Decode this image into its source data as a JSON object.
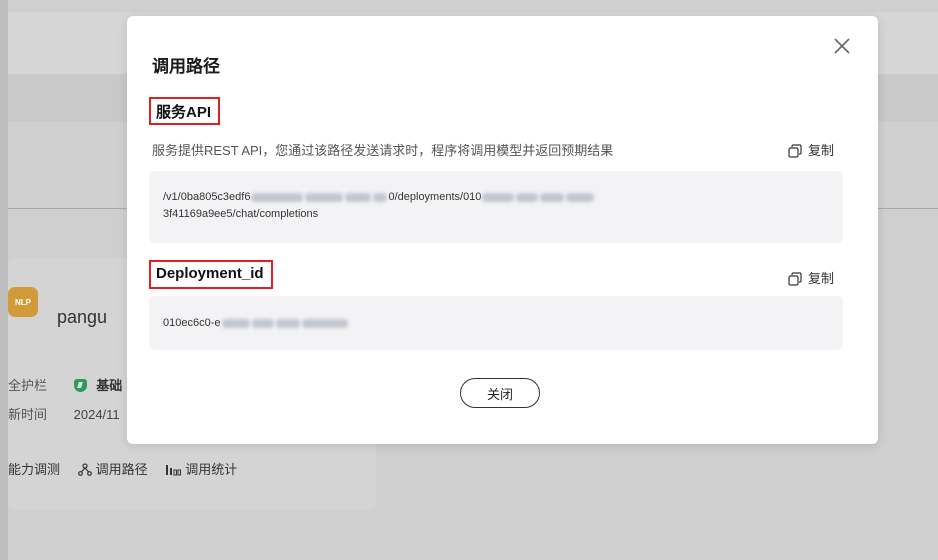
{
  "background": {
    "nlp_badge": "NLP",
    "model_name": "pangu",
    "rows": [
      {
        "label": "全护栏",
        "value": "基础"
      },
      {
        "label": "新时间",
        "value": "2024/11"
      }
    ],
    "actions": [
      {
        "label": "能力调测"
      },
      {
        "label": "调用路径"
      },
      {
        "label": "调用统计"
      }
    ]
  },
  "modal": {
    "title": "调用路径",
    "service_api": {
      "heading": "服务API",
      "description": "服务提供REST API，您通过该路径发送请求时，程序将调用模型并返回预期结果",
      "copy_label": "复制",
      "path_line1_start": "/v1/0ba805c3edf6",
      "path_line1_mid": "0/deployments/010",
      "path_line2": "3f41169a9ee5/chat/completions"
    },
    "deployment": {
      "heading": "Deployment_id",
      "copy_label": "复制",
      "value_start": "010ec6c0-e"
    },
    "close_label": "关闭"
  }
}
